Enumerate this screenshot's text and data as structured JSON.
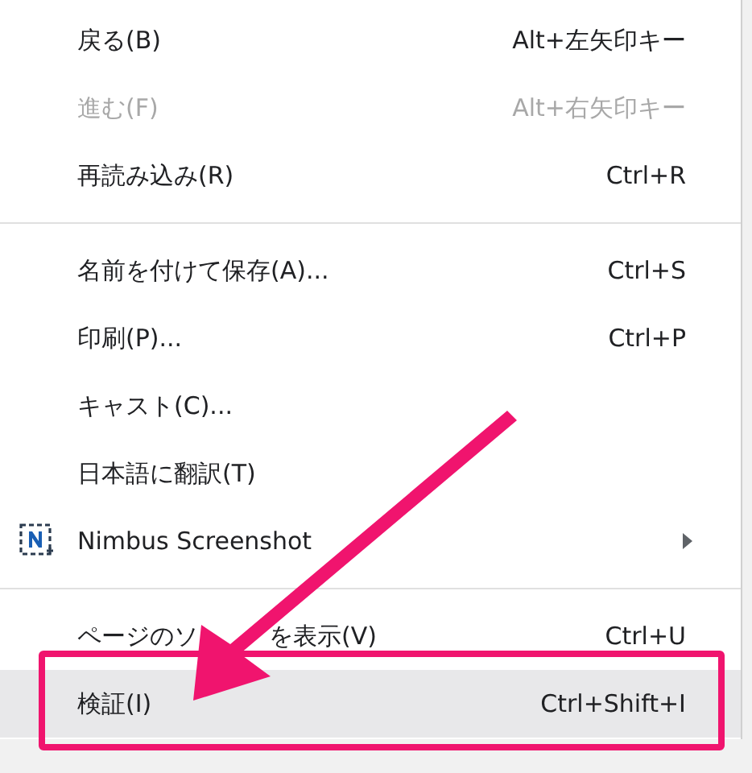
{
  "menu": {
    "groups": [
      {
        "items": [
          {
            "label": "戻る(B)",
            "shortcut": "Alt+左矢印キー",
            "disabled": false,
            "selected": false,
            "highlighted": false,
            "submenu": false,
            "kind": "plain"
          },
          {
            "label": "進む(F)",
            "shortcut": "Alt+右矢印キー",
            "disabled": true,
            "selected": false,
            "highlighted": false,
            "submenu": false,
            "kind": "plain"
          },
          {
            "label": "再読み込み(R)",
            "shortcut": "Ctrl+R",
            "disabled": false,
            "selected": false,
            "highlighted": false,
            "submenu": false,
            "kind": "plain"
          }
        ]
      },
      {
        "items": [
          {
            "label": "名前を付けて保存(A)...",
            "shortcut": "Ctrl+S",
            "disabled": false,
            "selected": false,
            "highlighted": false,
            "submenu": false,
            "kind": "plain"
          },
          {
            "label": "印刷(P)...",
            "shortcut": "Ctrl+P",
            "disabled": false,
            "selected": false,
            "highlighted": false,
            "submenu": false,
            "kind": "plain"
          },
          {
            "label": "キャスト(C)...",
            "disabled": false,
            "selected": false,
            "highlighted": false,
            "submenu": false,
            "kind": "plain"
          },
          {
            "label": "日本語に翻訳(T)",
            "disabled": false,
            "selected": false,
            "highlighted": false,
            "submenu": false,
            "kind": "plain"
          },
          {
            "label": "Nimbus Screenshot",
            "disabled": false,
            "selected": false,
            "highlighted": false,
            "submenu": true,
            "kind": "extension"
          }
        ]
      },
      {
        "items": [
          {
            "label_parts": [
              "ページのソ",
              "を表示(V)"
            ],
            "shortcut": "Ctrl+U",
            "disabled": false,
            "selected": false,
            "highlighted": false,
            "submenu": false,
            "kind": "plain"
          },
          {
            "label": "検証(I)",
            "shortcut": "Ctrl+Shift+I",
            "disabled": false,
            "selected": true,
            "highlighted": true,
            "submenu": false,
            "kind": "plain"
          }
        ]
      }
    ]
  },
  "annotation_arrow": true
}
